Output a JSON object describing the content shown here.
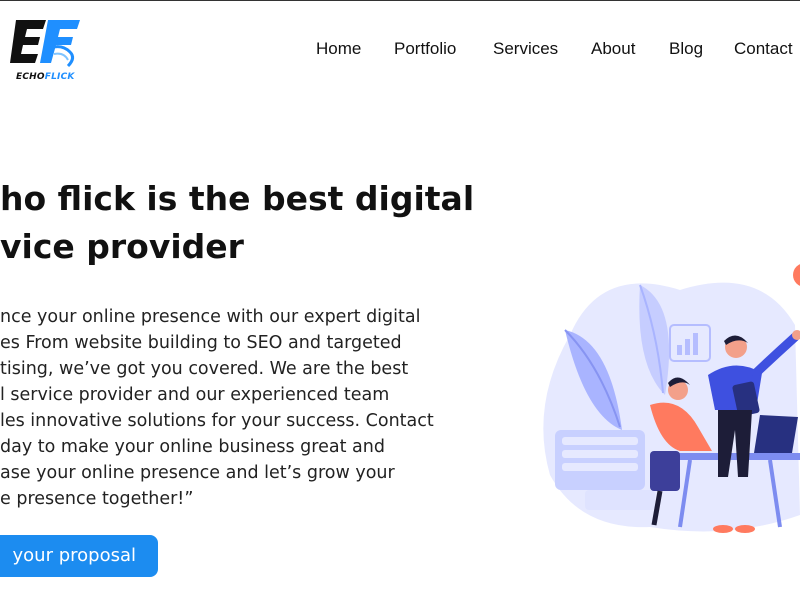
{
  "brand": {
    "logo_letters": "EF",
    "name_part1": "ECHO",
    "name_part2": "FLICK",
    "accent_color": "#1f8fff"
  },
  "nav": {
    "items": [
      "Home",
      "Portfolio",
      "Services",
      "About",
      "Blog",
      "Contact"
    ]
  },
  "hero": {
    "title_lines": [
      "ho flick is the best digital",
      "vice provider"
    ],
    "description_lines": [
      "nce your online presence with our expert digital",
      "es From website building to SEO and targeted",
      "tising, we’ve got you covered. We are the best",
      "l service provider and our experienced team",
      "les innovative solutions for your success. Contact",
      "day to make your online business great and",
      "ase your online presence and let’s grow your",
      "e presence together!”"
    ],
    "cta_label": "your proposal",
    "cta_color": "#1c8cf0"
  },
  "illustration": {
    "icon": "team-working-illustration"
  }
}
